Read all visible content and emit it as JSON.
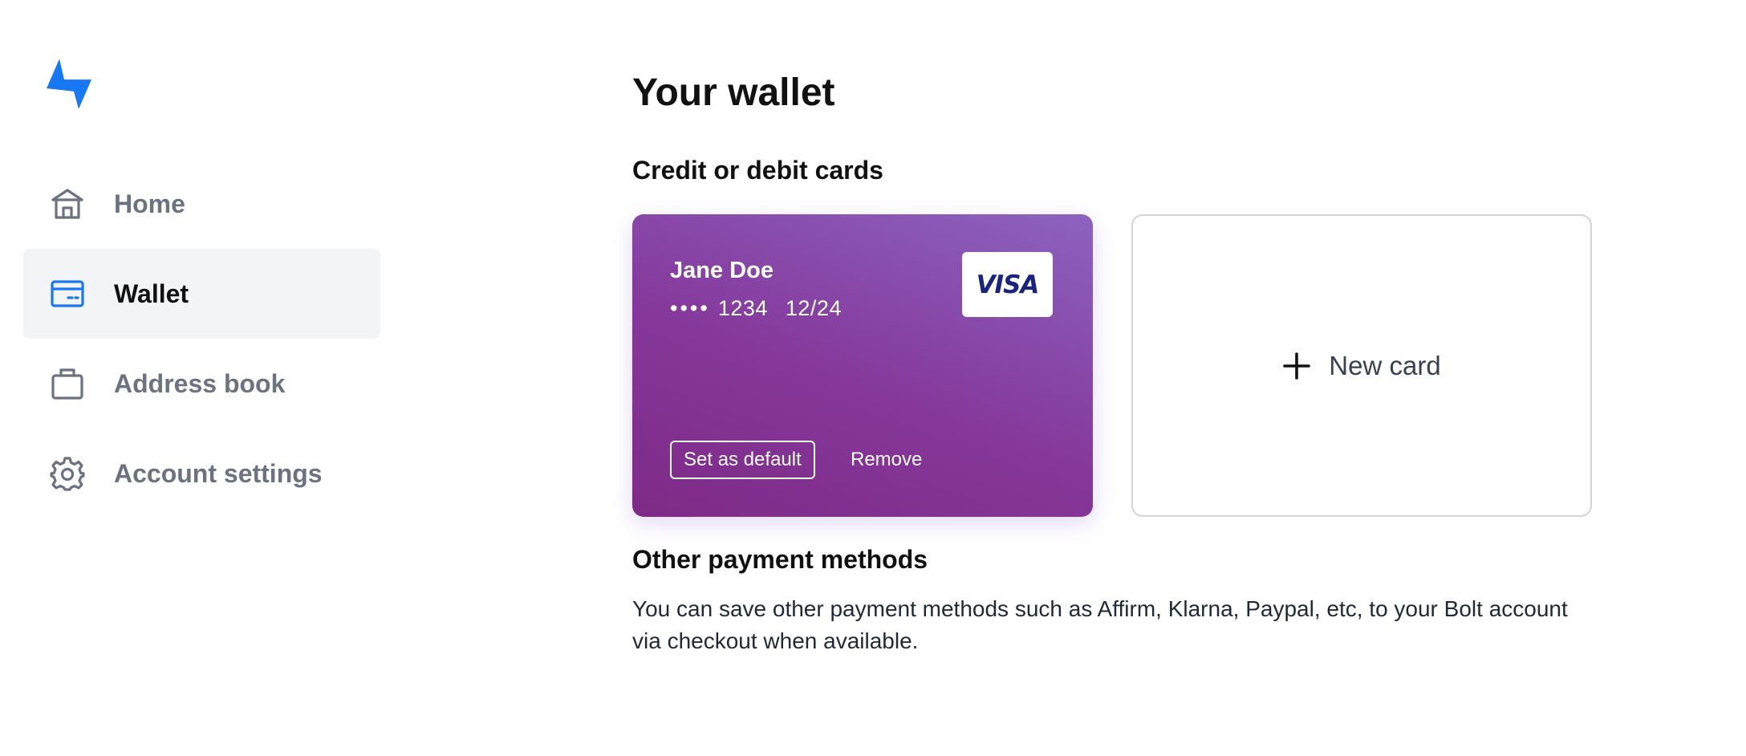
{
  "brand": {
    "logo_icon": "bolt-logo-icon",
    "accent_color": "#1877f2"
  },
  "sidebar": {
    "items": [
      {
        "label": "Home",
        "icon": "home-icon",
        "active": false
      },
      {
        "label": "Wallet",
        "icon": "credit-card-icon",
        "active": true
      },
      {
        "label": "Address book",
        "icon": "briefcase-icon",
        "active": false
      },
      {
        "label": "Account settings",
        "icon": "gear-icon",
        "active": false
      }
    ]
  },
  "main": {
    "title": "Your wallet",
    "cards_section": {
      "heading": "Credit or debit cards",
      "cards": [
        {
          "holder": "Jane Doe",
          "masked": "••••",
          "last4": "1234",
          "expiry": "12/24",
          "brand": "VISA",
          "set_default_label": "Set as default",
          "remove_label": "Remove",
          "gradient_colors": [
            "#7e2a87",
            "#8c63bf"
          ]
        }
      ],
      "new_card_label": "New card"
    },
    "other_section": {
      "heading": "Other payment methods",
      "text": "You can save other payment methods such as Affirm, Klarna, Paypal, etc, to your Bolt account via checkout when available."
    }
  }
}
